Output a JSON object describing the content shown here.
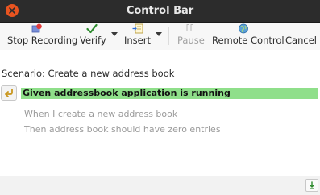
{
  "window": {
    "title": "Control Bar",
    "close_icon": "close-icon"
  },
  "toolbar": {
    "stop_recording": {
      "label": "Stop Recording",
      "icon": "record-stop-icon"
    },
    "verify": {
      "label": "Verify",
      "icon": "checkmark-icon"
    },
    "insert": {
      "label": "Insert",
      "icon": "insert-icon"
    },
    "pause": {
      "label": "Pause",
      "icon": "pause-icon",
      "enabled": false
    },
    "remote_control": {
      "label": "Remote Control",
      "icon": "globe-icon"
    },
    "cancel": {
      "label": "Cancel"
    }
  },
  "scenario": {
    "title": "Scenario: Create a new address book",
    "active_step": "Given addressbook application is running",
    "pending_steps": [
      "When I create a new address book",
      "Then address book should have zero entries"
    ]
  },
  "colors": {
    "titlebar": "#2c2c2c",
    "close": "#e95420",
    "highlight": "#8fdf8a",
    "pending_text": "#9a9a9a"
  }
}
